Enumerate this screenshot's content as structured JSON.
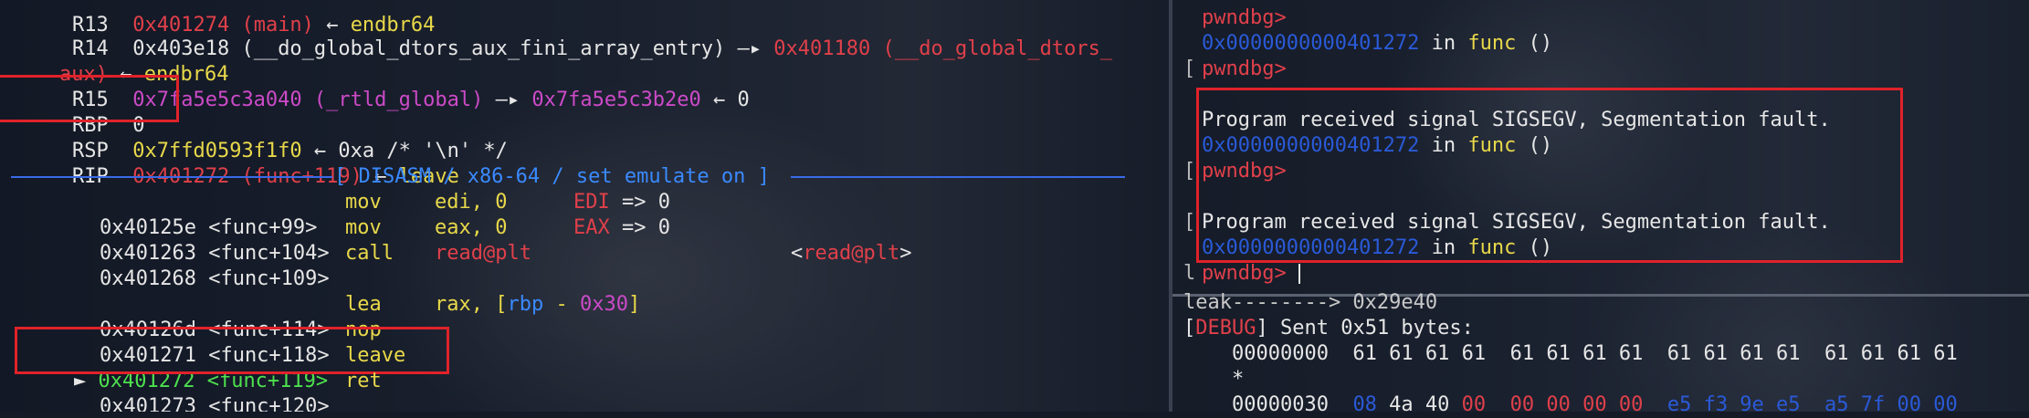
{
  "left": {
    "r13": {
      "reg": "R13",
      "addr": "0x401274",
      "sym": "(main)",
      "arrow": "←",
      "val": "endbr64"
    },
    "r14": {
      "reg": "R14",
      "addr": "0x403e18",
      "sym": "(__do_global_dtors_aux_fini_array_entry)",
      "arrow": "—▸",
      "ptr": "0x401180",
      "ptr_sym": "(__do_global_dtors_",
      "cont": "aux)",
      "arrow2": "←",
      "val": "endbr64"
    },
    "r15": {
      "reg": "R15",
      "addr": "0x7fa5e5c3a040",
      "sym": "(_rtld_global)",
      "arrow": "—▸",
      "ptr": "0x7fa5e5c3b2e0",
      "arrow2": "←",
      "val": "0"
    },
    "rbp": {
      "reg": "RBP",
      "val": "0"
    },
    "rsp": {
      "reg": "RSP",
      "addr": "0x7ffd0593f1f0",
      "arrow": "←",
      "val": "0xa /* '\\n' */"
    },
    "rip": {
      "reg": "RIP",
      "addr": "0x401272",
      "sym": "(func+119)",
      "arrow": "←",
      "val": "leave"
    },
    "disasm_header": "[ DISASM / x86-64 / set emulate on ]",
    "disasm": [
      {
        "addr": "0x40125e",
        "sym": "<func+99>",
        "op": "mov",
        "args": "edi, 0",
        "note_reg": "EDI",
        "note_arrow": "=>",
        "note_val": "0"
      },
      {
        "addr": "0x401263",
        "sym": "<func+104>",
        "op": "mov",
        "args": "eax, 0",
        "note_reg": "EAX",
        "note_arrow": "=>",
        "note_val": "0"
      },
      {
        "addr": "0x401268",
        "sym": "<func+109>",
        "op": "call",
        "target": "read@plt",
        "target2": "<read@plt>"
      },
      {
        "addr": "0x40126d",
        "sym": "<func+114>",
        "op": "lea",
        "args_a": "rax, [",
        "args_reg": "rbp",
        "args_mid": " - ",
        "args_off": "0x30",
        "args_end": "]"
      },
      {
        "addr": "0x401271",
        "sym": "<func+118>",
        "op": "nop"
      },
      {
        "marker": "►",
        "addr": "0x401272",
        "sym": "<func+119>",
        "op": "leave"
      },
      {
        "addr": "0x401273",
        "sym": "<func+120>",
        "op": "ret"
      }
    ]
  },
  "right": {
    "prompt": "pwndbg>",
    "line_func1": {
      "addr": "0x0000000000401272",
      "in": "in",
      "func": "func",
      "args": "()"
    },
    "prompt2": "pwndbg>",
    "signal1": "Program received signal SIGSEGV, Segmentation fault.",
    "line_func2": {
      "addr": "0x0000000000401272",
      "in": "in",
      "func": "func",
      "args": "()"
    },
    "prompt3": "pwndbg>",
    "signal2": "Program received signal SIGSEGV, Segmentation fault.",
    "line_func3": {
      "addr": "0x0000000000401272",
      "in": "in",
      "func": "func",
      "args": "()"
    },
    "prompt4": "pwndbg>",
    "leak_line": "leak--------> 0x29e40",
    "debug_tag": "DEBUG",
    "debug_msg": "Sent 0x51 bytes:",
    "hex_row1": "    00000000  61 61 61 61  61 61 61 61  61 61 61 61  61 61 61 61",
    "hex_star": "    *",
    "hex_row3_off": "    00000030  ",
    "hex_row3_a": "08",
    "hex_row3_b": " 4a 40 ",
    "hex_row3_c": "00  00 00 00 00",
    "hex_row3_d": "  e5 f3 9e e5  a5 7f 00 00",
    "side_brackets": [
      "[",
      "[",
      "[",
      "l"
    ]
  },
  "colors": {
    "highlight": "#e0222a",
    "address": "#e0404a",
    "symbol": "#cc4ac8",
    "opcode": "#e8d84a",
    "current": "#4ee04e",
    "rule": "#3a6ae8"
  }
}
